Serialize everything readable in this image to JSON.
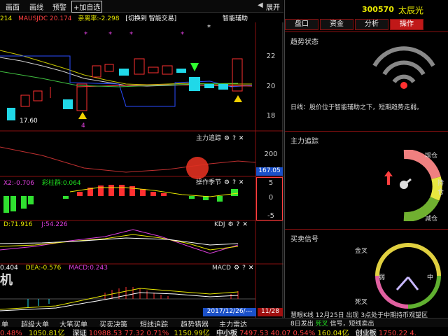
{
  "toolbar": {
    "btn1": "画面",
    "btn2": "画线",
    "btn3": "预警",
    "btn4": "+加自选",
    "btn5": "◀",
    "btn6": "展开"
  },
  "indicator_line": {
    "a": "214",
    "b": "MAUSJDC 20.174",
    "c": "亲离率:-2.298",
    "d": "[切换到 智能交易]",
    "e": "智能辅助"
  },
  "main_chart": {
    "price_labels": [
      "22",
      "20",
      "18"
    ],
    "low_label": "17.60"
  },
  "panel_zhuli": {
    "title": "主力追踪",
    "axis": [
      "200",
      "0"
    ],
    "current_value": "167.05"
  },
  "panel_jiaoyi": {
    "header": "X2:-0.706",
    "series": "彩柱群:0.064",
    "title": "操作季节",
    "axis": [
      "5",
      "0",
      "-5"
    ]
  },
  "panel_kdj": {
    "k": "D:71.916",
    "j": "J:54.226",
    "title": "KDJ"
  },
  "panel_macd": {
    "dif": "0.404",
    "dea": "DEA:-0.576",
    "macd": "MACD:0.243",
    "title": "MACD",
    "overlay": "机"
  },
  "date_label": "2017/12/26/---",
  "right_axis_bottom": "11/28",
  "stock": {
    "code": "300570",
    "name": "太辰光"
  },
  "tabs": [
    "盘口",
    "资金",
    "分析",
    "操作"
  ],
  "active_tab": "操作",
  "trend": {
    "title": "趋势状态",
    "text": "日线：股价位于智能辅助之下，短期趋势走弱。"
  },
  "zhuli": {
    "title": "主力追踪",
    "gauge_labels": [
      "增仓",
      "持仓",
      "减仓"
    ]
  },
  "signal": {
    "title": "买卖信号",
    "dial_labels": [
      "金叉",
      "中",
      "弱",
      "死叉"
    ],
    "text1": "慧眼K线  12月25日  出现  3点处于中期持币观望区",
    "text2": "8日发出",
    "text2b": "死叉",
    "text2c": "信号，短线卖出"
  },
  "bottom_tabs": [
    "单",
    "超级大单",
    "大笔买单",
    "买卖决策",
    "短线追踪",
    "趋势猎器",
    "主力雷达"
  ],
  "ticker": {
    "t1": "0.48%",
    "t2": "1050.81亿",
    "t3": "深证",
    "t4": "10988.53",
    "t5": "77.32",
    "t6": "0.71%",
    "t7": "1150.99亿",
    "t8": "中小板",
    "t9": "7497.53",
    "t10": "40.07",
    "t11": "0.54%",
    "t12": "160.04亿",
    "t13": "创业板",
    "t14": "1750.22",
    "t15": "4."
  },
  "colors": {
    "up": "#ff3030",
    "down": "#20d8e8",
    "panel_border": "#8a1010",
    "accent": "#c01818"
  }
}
